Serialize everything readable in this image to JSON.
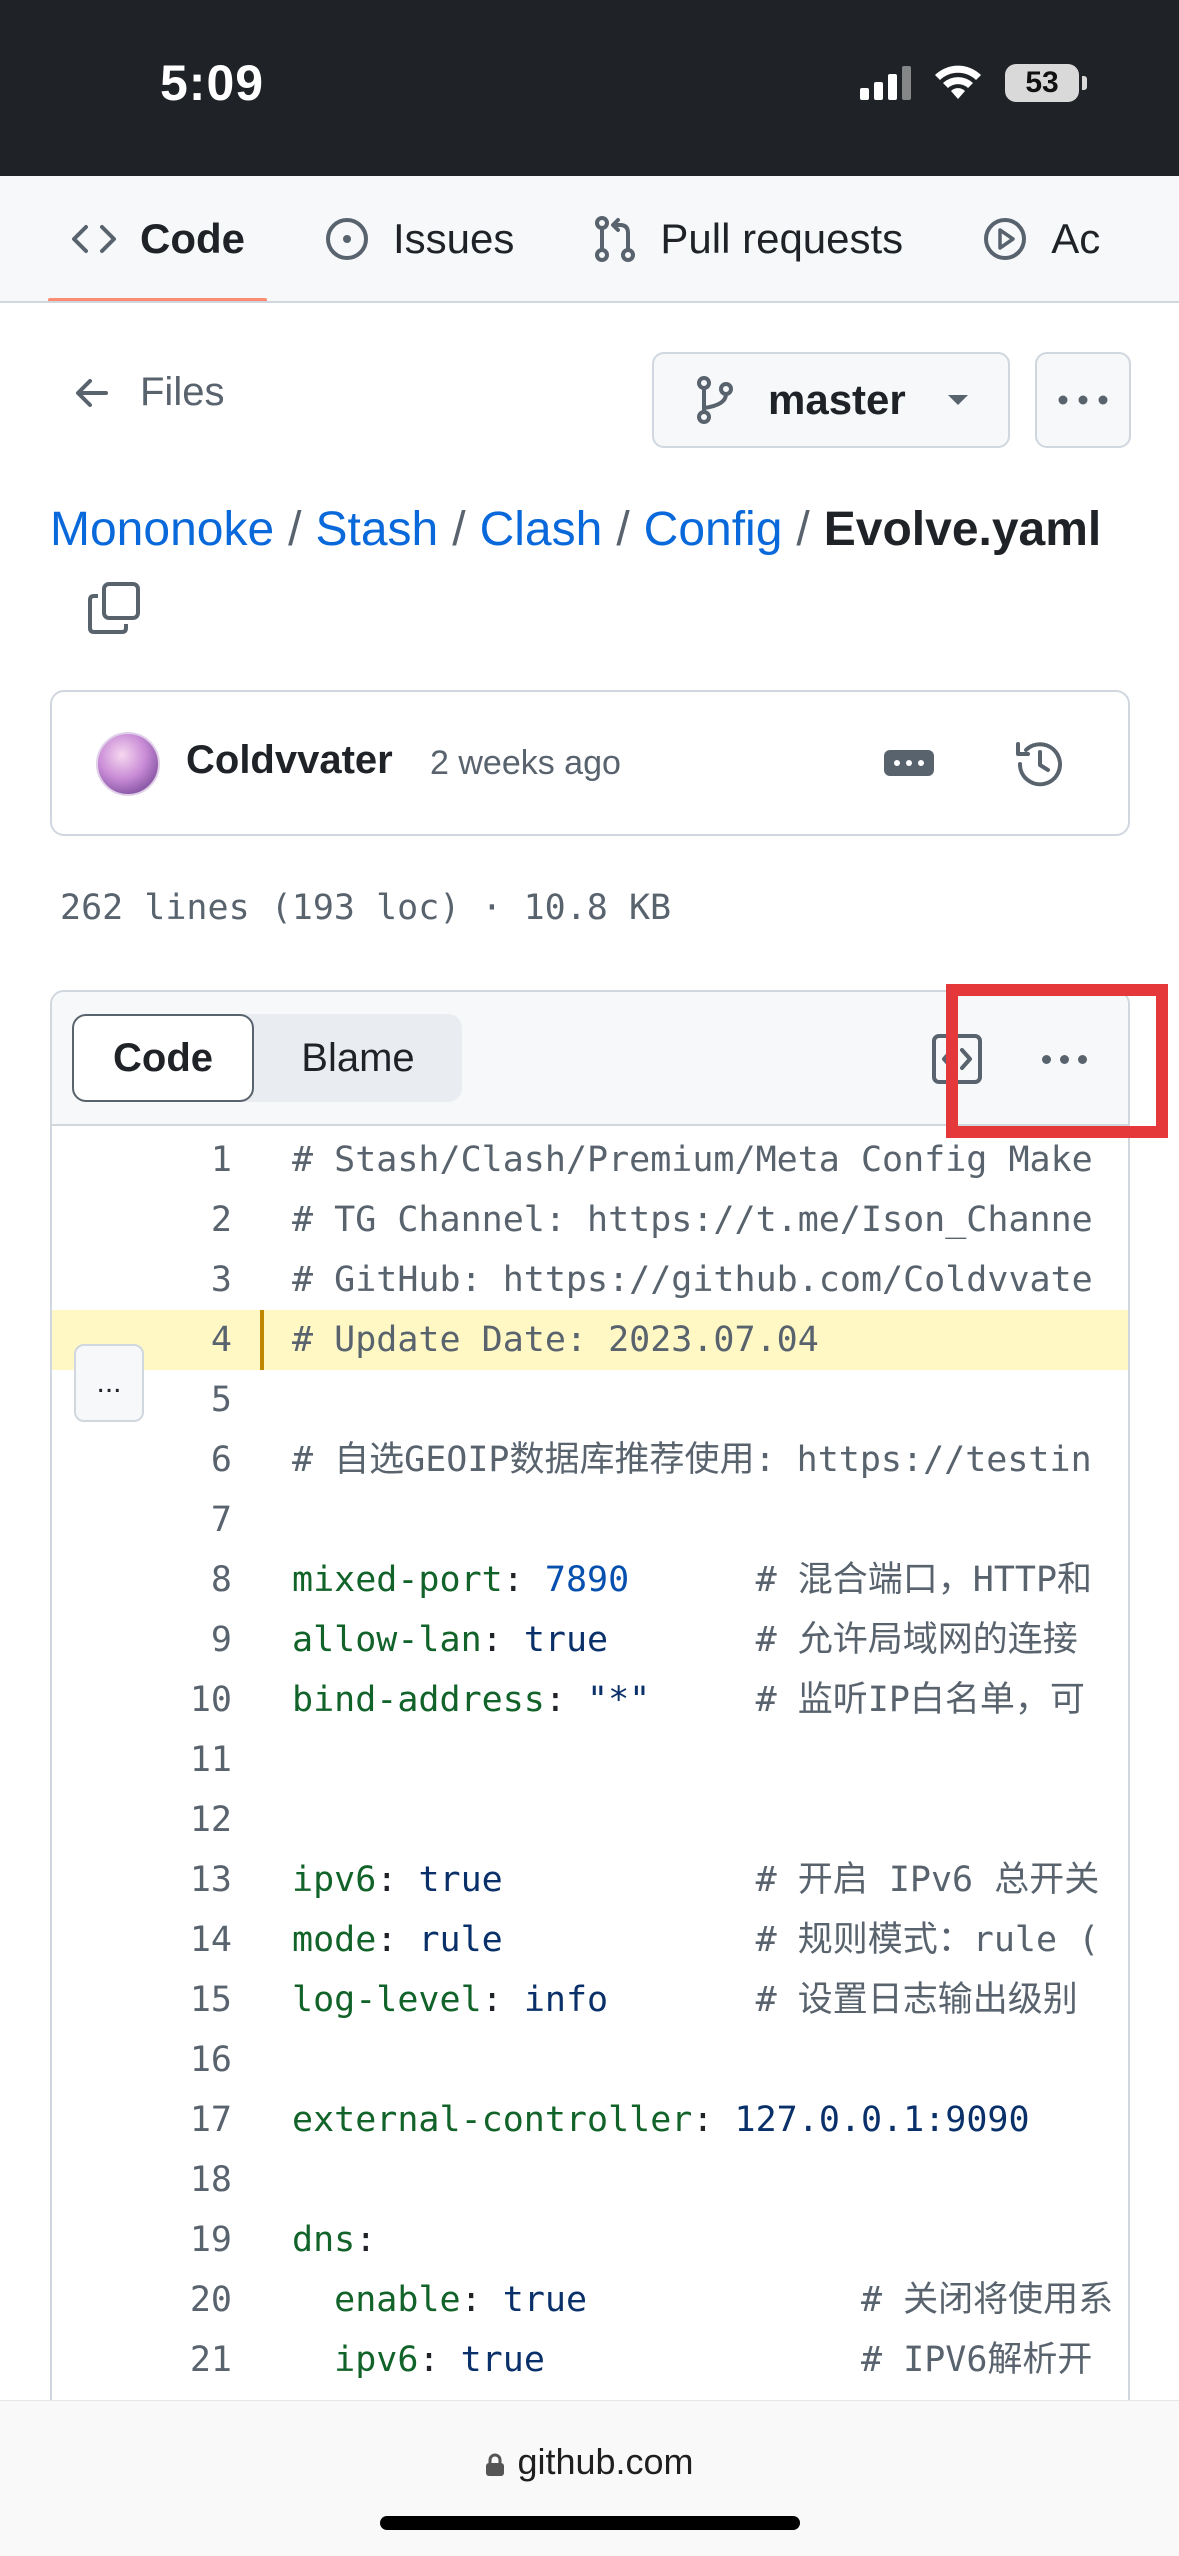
{
  "status_bar": {
    "time": "5:09",
    "battery": "53"
  },
  "repo_tabs": [
    {
      "label": "Code",
      "icon": "code-icon",
      "active": true
    },
    {
      "label": "Issues",
      "icon": "issue-circle-icon",
      "active": false
    },
    {
      "label": "Pull requests",
      "icon": "pull-request-icon",
      "active": false
    },
    {
      "label": "Ac",
      "icon": "play-circle-icon",
      "active": false
    }
  ],
  "files_nav": {
    "back_label": "Files",
    "branch": "master"
  },
  "breadcrumb": {
    "parts": [
      "Mononoke",
      "Stash",
      "Clash",
      "Config"
    ],
    "separator": "/",
    "current": "Evolve.yaml"
  },
  "commit": {
    "author": "Coldvvater",
    "time_ago": "2 weeks ago"
  },
  "file_info": "262 lines (193 loc) · 10.8 KB",
  "code_panel": {
    "tabs": {
      "code": "Code",
      "blame": "Blame"
    },
    "expand_label": "...",
    "highlighted_line": 4,
    "lines": [
      {
        "n": "1",
        "tokens": [
          {
            "t": "# Stash/Clash/Premium/Meta Config Make",
            "c": "com"
          }
        ]
      },
      {
        "n": "2",
        "tokens": [
          {
            "t": "# TG Channel: https://t.me/Ison_Channe",
            "c": "com"
          }
        ]
      },
      {
        "n": "3",
        "tokens": [
          {
            "t": "# GitHub: https://github.com/Coldvvate",
            "c": "com"
          }
        ]
      },
      {
        "n": "4",
        "tokens": [
          {
            "t": "# Update Date: 2023.07.04",
            "c": "com"
          }
        ]
      },
      {
        "n": "5",
        "tokens": []
      },
      {
        "n": "6",
        "tokens": [
          {
            "t": "# 自选GEOIP数据库推荐使用: https://testin",
            "c": "com"
          }
        ]
      },
      {
        "n": "7",
        "tokens": []
      },
      {
        "n": "8",
        "tokens": [
          {
            "t": "mixed-port",
            "c": "key"
          },
          {
            "t": ": ",
            "c": "p"
          },
          {
            "t": "7890",
            "c": "num"
          },
          {
            "t": "      ",
            "c": "p"
          },
          {
            "t": "# 混合端口，HTTP和",
            "c": "com"
          }
        ]
      },
      {
        "n": "9",
        "tokens": [
          {
            "t": "allow-lan",
            "c": "key"
          },
          {
            "t": ": ",
            "c": "p"
          },
          {
            "t": "true",
            "c": "val"
          },
          {
            "t": "       ",
            "c": "p"
          },
          {
            "t": "# 允许局域网的连接",
            "c": "com"
          }
        ]
      },
      {
        "n": "10",
        "tokens": [
          {
            "t": "bind-address",
            "c": "key"
          },
          {
            "t": ": ",
            "c": "p"
          },
          {
            "t": "\"*\"",
            "c": "val"
          },
          {
            "t": "     ",
            "c": "p"
          },
          {
            "t": "# 监听IP白名单，可",
            "c": "com"
          }
        ]
      },
      {
        "n": "11",
        "tokens": []
      },
      {
        "n": "12",
        "tokens": []
      },
      {
        "n": "13",
        "tokens": [
          {
            "t": "ipv6",
            "c": "key"
          },
          {
            "t": ": ",
            "c": "p"
          },
          {
            "t": "true",
            "c": "val"
          },
          {
            "t": "            ",
            "c": "p"
          },
          {
            "t": "# 开启 IPv6 总开关",
            "c": "com"
          }
        ]
      },
      {
        "n": "14",
        "tokens": [
          {
            "t": "mode",
            "c": "key"
          },
          {
            "t": ": ",
            "c": "p"
          },
          {
            "t": "rule",
            "c": "val"
          },
          {
            "t": "            ",
            "c": "p"
          },
          {
            "t": "# 规则模式：rule (",
            "c": "com"
          }
        ]
      },
      {
        "n": "15",
        "tokens": [
          {
            "t": "log-level",
            "c": "key"
          },
          {
            "t": ": ",
            "c": "p"
          },
          {
            "t": "info",
            "c": "val"
          },
          {
            "t": "       ",
            "c": "p"
          },
          {
            "t": "# 设置日志输出级别",
            "c": "com"
          }
        ]
      },
      {
        "n": "16",
        "tokens": []
      },
      {
        "n": "17",
        "tokens": [
          {
            "t": "external-controller",
            "c": "key"
          },
          {
            "t": ": ",
            "c": "p"
          },
          {
            "t": "127.0.0.1:9090",
            "c": "val"
          }
        ]
      },
      {
        "n": "18",
        "tokens": []
      },
      {
        "n": "19",
        "tokens": [
          {
            "t": "dns",
            "c": "key"
          },
          {
            "t": ":",
            "c": "p"
          }
        ]
      },
      {
        "n": "20",
        "tokens": [
          {
            "t": "  ",
            "c": "p"
          },
          {
            "t": "enable",
            "c": "key"
          },
          {
            "t": ": ",
            "c": "p"
          },
          {
            "t": "true",
            "c": "val"
          },
          {
            "t": "             ",
            "c": "p"
          },
          {
            "t": "# 关闭将使用系",
            "c": "com"
          }
        ]
      },
      {
        "n": "21",
        "tokens": [
          {
            "t": "  ",
            "c": "p"
          },
          {
            "t": "ipv6",
            "c": "key"
          },
          {
            "t": ": ",
            "c": "p"
          },
          {
            "t": "true",
            "c": "val"
          },
          {
            "t": "               ",
            "c": "p"
          },
          {
            "t": "# IPV6解析开",
            "c": "com"
          }
        ]
      }
    ]
  },
  "url_bar": {
    "domain": "github.com"
  },
  "colors": {
    "accent_underline": "#fd8c73",
    "link": "#0969da",
    "highlight_line": "#fff8c5",
    "annotation_box": "#e5383b"
  }
}
